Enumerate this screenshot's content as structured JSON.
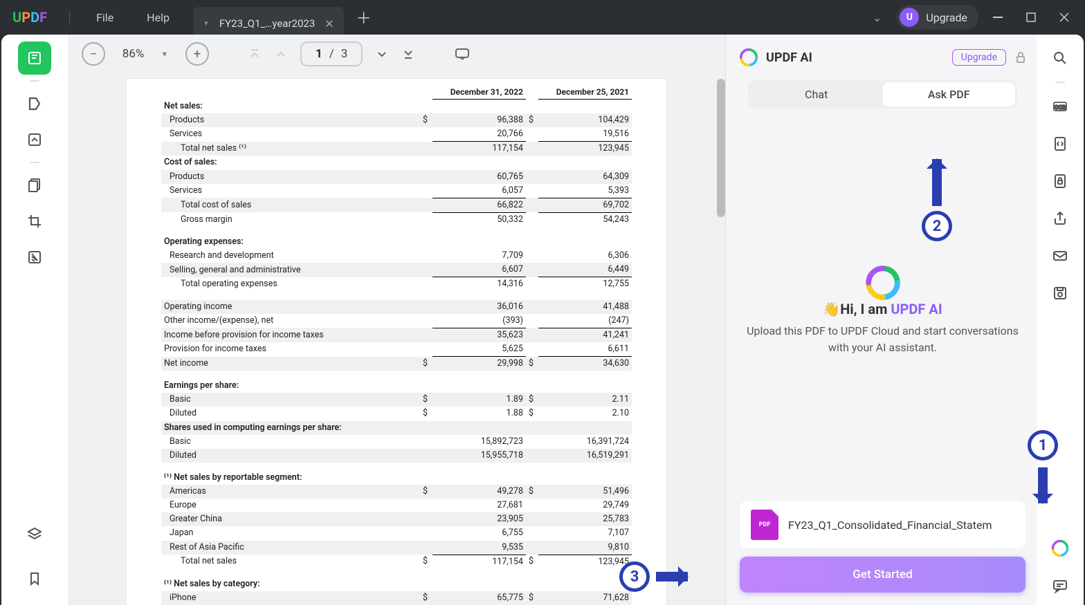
{
  "titlebar": {
    "logo": "UPDF",
    "file": "File",
    "help": "Help",
    "tabTitle": "FY23_Q1_…year2023",
    "upgrade": "Upgrade",
    "upgradeLetter": "U"
  },
  "toolbar": {
    "zoom": "86%",
    "pageCurrent": "1",
    "pageSep": "/",
    "pageTotal": "3"
  },
  "doc": {
    "col1": "December 31, 2022",
    "col2": "December 25, 2021",
    "rows": [
      {
        "label": "Net sales:",
        "type": "header"
      },
      {
        "label": "Products",
        "d1": "$",
        "v1": "96,388",
        "d2": "$",
        "v2": "104,429",
        "indent": 1,
        "shade": 1
      },
      {
        "label": "Services",
        "v1": "20,766",
        "v2": "19,516",
        "indent": 1
      },
      {
        "label": "Total net sales ⁽¹⁾",
        "v1": "117,154",
        "v2": "123,945",
        "indent": 2,
        "ul": 1,
        "shade": 1
      },
      {
        "label": "Cost of sales:",
        "type": "header"
      },
      {
        "label": "Products",
        "v1": "60,765",
        "v2": "64,309",
        "indent": 1,
        "shade": 1
      },
      {
        "label": "Services",
        "v1": "6,057",
        "v2": "5,393",
        "indent": 1
      },
      {
        "label": "Total cost of sales",
        "v1": "66,822",
        "v2": "69,702",
        "indent": 2,
        "ul": 1,
        "shade": 1
      },
      {
        "label": "Gross margin",
        "v1": "50,332",
        "v2": "54,243",
        "indent": 2,
        "ul": 1
      },
      {
        "label": "",
        "type": "spacer"
      },
      {
        "label": "Operating expenses:",
        "type": "header"
      },
      {
        "label": "Research and development",
        "v1": "7,709",
        "v2": "6,306",
        "indent": 1
      },
      {
        "label": "Selling, general and administrative",
        "v1": "6,607",
        "v2": "6,449",
        "indent": 1,
        "shade": 1
      },
      {
        "label": "Total operating expenses",
        "v1": "14,316",
        "v2": "12,755",
        "indent": 2,
        "ul": 1
      },
      {
        "label": "",
        "type": "spacer"
      },
      {
        "label": "Operating income",
        "v1": "36,016",
        "v2": "41,488",
        "shade": 1
      },
      {
        "label": "Other income/(expense), net",
        "v1": "(393)",
        "v2": "(247)"
      },
      {
        "label": "Income before provision for income taxes",
        "v1": "35,623",
        "v2": "41,241",
        "ul": 1,
        "shade": 1
      },
      {
        "label": "Provision for income taxes",
        "v1": "5,625",
        "v2": "6,611"
      },
      {
        "label": "Net income",
        "d1": "$",
        "v1": "29,998",
        "d2": "$",
        "v2": "34,630",
        "ul": 1,
        "shade": 1
      },
      {
        "label": "",
        "type": "spacer"
      },
      {
        "label": "Earnings per share:",
        "type": "header"
      },
      {
        "label": "Basic",
        "d1": "$",
        "v1": "1.89",
        "d2": "$",
        "v2": "2.11",
        "indent": 1,
        "shade": 1
      },
      {
        "label": "Diluted",
        "d1": "$",
        "v1": "1.88",
        "d2": "$",
        "v2": "2.10",
        "indent": 1
      },
      {
        "label": "Shares used in computing earnings per share:",
        "type": "header",
        "shade": 1
      },
      {
        "label": "Basic",
        "v1": "15,892,723",
        "v2": "16,391,724",
        "indent": 1
      },
      {
        "label": "Diluted",
        "v1": "15,955,718",
        "v2": "16,519,291",
        "indent": 1,
        "shade": 1
      },
      {
        "label": "",
        "type": "spacer"
      },
      {
        "label": "⁽¹⁾ Net sales by reportable segment:",
        "type": "header"
      },
      {
        "label": "Americas",
        "d1": "$",
        "v1": "49,278",
        "d2": "$",
        "v2": "51,496",
        "indent": 1,
        "shade": 1
      },
      {
        "label": "Europe",
        "v1": "27,681",
        "v2": "29,749",
        "indent": 1
      },
      {
        "label": "Greater China",
        "v1": "23,905",
        "v2": "25,783",
        "indent": 1,
        "shade": 1
      },
      {
        "label": "Japan",
        "v1": "6,755",
        "v2": "7,107",
        "indent": 1
      },
      {
        "label": "Rest of Asia Pacific",
        "v1": "9,535",
        "v2": "9,810",
        "indent": 1,
        "shade": 1
      },
      {
        "label": "Total net sales",
        "d1": "$",
        "v1": "117,154",
        "d2": "$",
        "v2": "123,945",
        "indent": 2,
        "ul": 1
      },
      {
        "label": "",
        "type": "spacer"
      },
      {
        "label": "⁽¹⁾ Net sales by category:",
        "type": "header"
      },
      {
        "label": "iPhone",
        "d1": "$",
        "v1": "65,775",
        "d2": "$",
        "v2": "71,628",
        "indent": 1,
        "shade": 1
      }
    ]
  },
  "ai": {
    "title": "UPDF AI",
    "upgrade": "Upgrade",
    "tabChat": "Chat",
    "tabAsk": "Ask PDF",
    "greetPrefix": "Hi, I am ",
    "greetBrand": "UPDF AI",
    "wave": "👋",
    "desc": "Upload this PDF to UPDF Cloud and start conversations with your AI assistant.",
    "fileBadge": "PDF",
    "fileName": "FY23_Q1_Consolidated_Financial_Statem",
    "getStarted": "Get Started"
  },
  "annotations": {
    "one": "1",
    "two": "2",
    "three": "3"
  }
}
